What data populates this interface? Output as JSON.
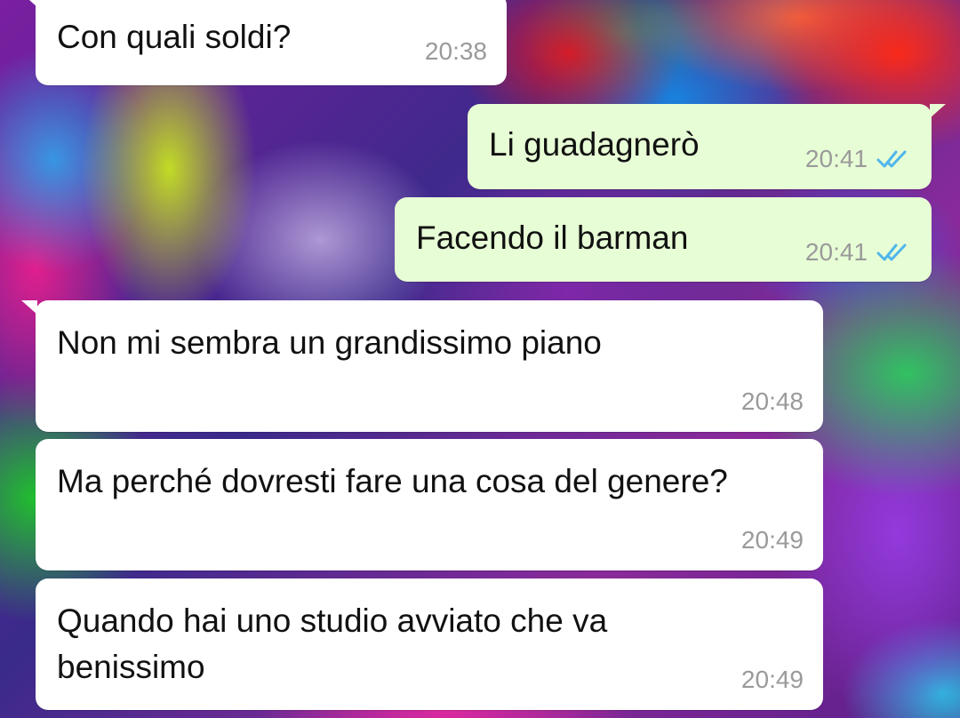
{
  "chat": {
    "colors": {
      "incoming_bubble": "#ffffff",
      "outgoing_bubble": "#e7fdd5",
      "timestamp": "#9a9a9a",
      "read_ticks": "#4fb6ec"
    },
    "messages": [
      {
        "direction": "incoming",
        "text": "Con quali soldi?",
        "time": "20:38"
      },
      {
        "direction": "outgoing",
        "text": "Li guadagnerò",
        "time": "20:41",
        "status": "read",
        "status_icon": "double-check-icon"
      },
      {
        "direction": "outgoing",
        "text": "Facendo il barman",
        "time": "20:41",
        "status": "read",
        "status_icon": "double-check-icon"
      },
      {
        "direction": "incoming",
        "text": "Non mi sembra un grandissimo piano",
        "time": "20:48"
      },
      {
        "direction": "incoming",
        "text": "Ma perché dovresti fare una cosa del genere?",
        "time": "20:49"
      },
      {
        "direction": "incoming",
        "text": "Quando hai uno studio avviato che va benissimo",
        "time": "20:49"
      }
    ]
  }
}
